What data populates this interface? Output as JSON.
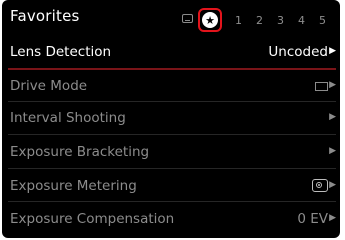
{
  "header": {
    "title": "Favorites",
    "tabs": {
      "icon_tab": "menu-screen-icon",
      "favorites_icon": "star-icon",
      "numbers": [
        "1",
        "2",
        "3",
        "4",
        "5"
      ]
    }
  },
  "menu": {
    "items": [
      {
        "label": "Lens Detection",
        "value": "Uncoded",
        "state": "selected"
      },
      {
        "label": "Drive Mode",
        "value_icon": "single-frame-icon",
        "state": "dim"
      },
      {
        "label": "Interval Shooting",
        "state": "dim"
      },
      {
        "label": "Exposure Bracketing",
        "state": "dim"
      },
      {
        "label": "Exposure Metering",
        "value_icon": "center-weighted-metering-icon",
        "state": "dim"
      },
      {
        "label": "Exposure Compensation",
        "value": "0 EV",
        "state": "dim"
      }
    ]
  },
  "colors": {
    "background": "#000000",
    "highlight": "#e3141c",
    "active_line": "#7a1418",
    "text": "#ffffff",
    "dim_text": "#8c8c8c"
  }
}
